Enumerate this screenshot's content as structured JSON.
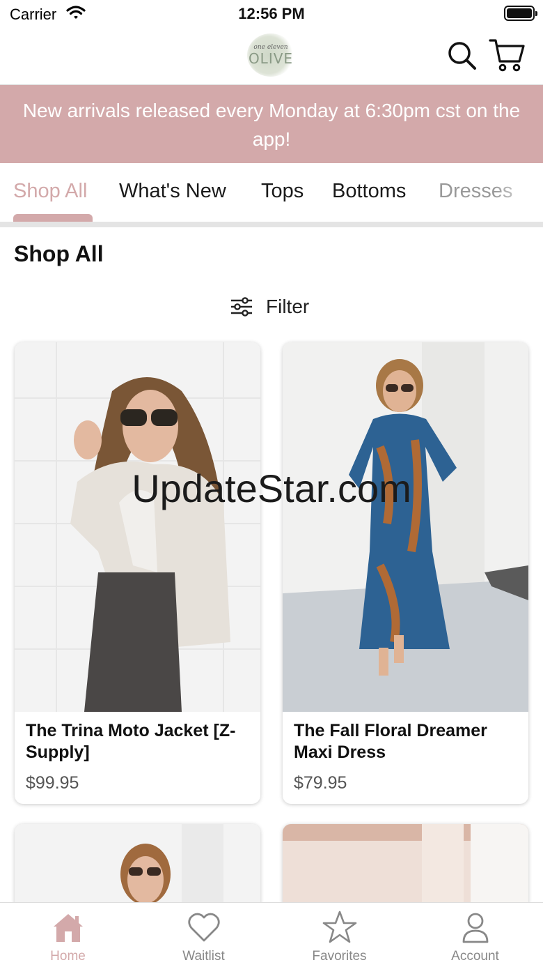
{
  "status_bar": {
    "carrier": "Carrier",
    "time": "12:56 PM"
  },
  "header": {
    "logo_small": "one eleven",
    "logo_big": "OLIVE",
    "search_icon": "search-icon",
    "cart_icon": "cart-icon"
  },
  "banner": {
    "text": "New arrivals released every Monday at 6:30pm cst on the app!"
  },
  "tabs": [
    {
      "label": "Shop All",
      "active": true
    },
    {
      "label": "What's New"
    },
    {
      "label": "Tops"
    },
    {
      "label": "Bottoms"
    },
    {
      "label": "Dresses"
    }
  ],
  "section": {
    "title": "Shop All",
    "filter_label": "Filter",
    "filter_icon": "sliders-icon"
  },
  "products": [
    {
      "name": "The Trina Moto Jacket [Z-Supply]",
      "price": "$99.95"
    },
    {
      "name": "The Fall Floral Dreamer Maxi Dress",
      "price": "$79.95"
    }
  ],
  "watermark": "UpdateStar.com",
  "bottom_nav": [
    {
      "label": "Home",
      "icon": "home-icon",
      "active": true
    },
    {
      "label": "Waitlist",
      "icon": "heart-icon"
    },
    {
      "label": "Favorites",
      "icon": "star-icon"
    },
    {
      "label": "Account",
      "icon": "person-icon"
    }
  ],
  "colors": {
    "accent": "#d3a9aa",
    "text": "#111111",
    "muted": "#888888"
  }
}
